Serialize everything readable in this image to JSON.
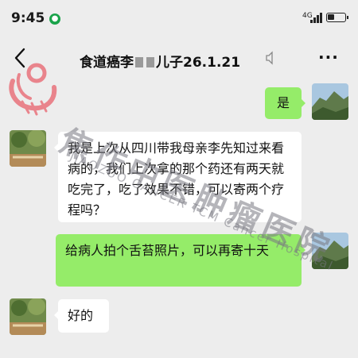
{
  "status_bar": {
    "time": "9:45",
    "network": "4G",
    "battery_level": 0.4
  },
  "header": {
    "title_prefix": "食道癌李",
    "title_suffix": "儿子26.1.21",
    "more_label": "···"
  },
  "messages": [
    {
      "side": "right",
      "text": "是"
    },
    {
      "side": "left",
      "text": "我是上次从四川带我母亲李先知过来看病的，我们上次拿的那个药还有两天就吃完了，吃了效果不错，可以寄两个疗程吗？"
    },
    {
      "side": "right",
      "text": "给病人拍个舌苔照片，可以再寄十天"
    },
    {
      "side": "left",
      "text": "好的"
    }
  ],
  "watermark": {
    "cn": "焦作中医肿瘤医院",
    "en": "JIAOZUO CANCER TCM Cancer Hospital"
  },
  "colors": {
    "background": "#ededed",
    "bubble_sent": "#95ec69",
    "bubble_received": "#ffffff",
    "watermark_logo": "#e8616c"
  }
}
